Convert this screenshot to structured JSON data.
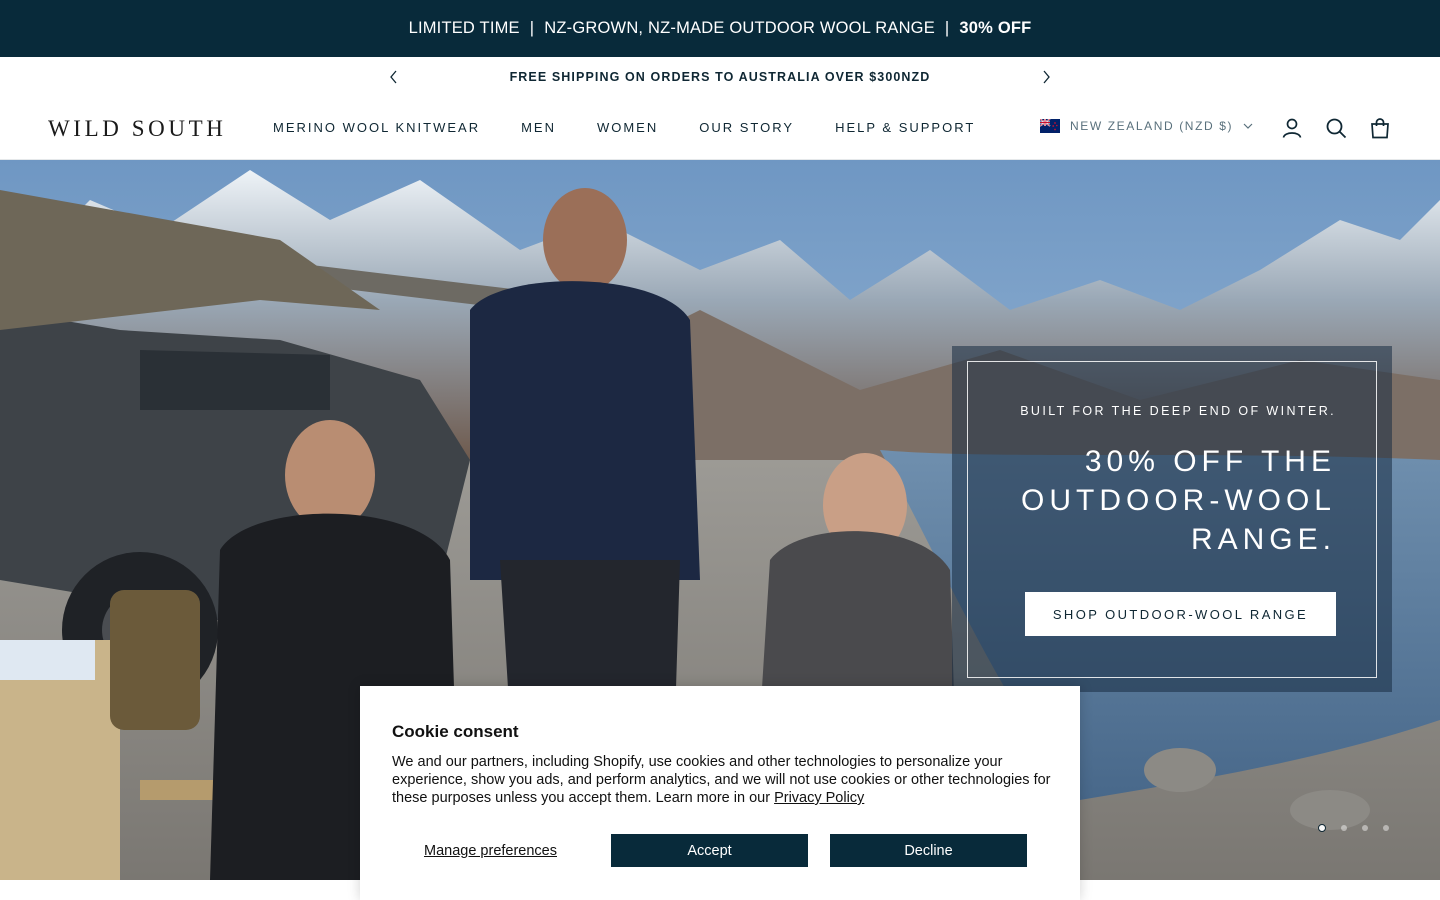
{
  "announcement": {
    "part1": "LIMITED TIME",
    "separator": "|",
    "part2": "NZ-GROWN, NZ-MADE OUTDOOR WOOL RANGE",
    "highlight": "30% OFF"
  },
  "shipping_bar": {
    "text": "FREE SHIPPING ON ORDERS TO AUSTRALIA OVER $300NZD",
    "prev_icon": "chevron-left-icon",
    "next_icon": "chevron-right-icon"
  },
  "header": {
    "logo": "WILD SOUTH",
    "nav": [
      {
        "label": "MERINO WOOL KNITWEAR"
      },
      {
        "label": "MEN"
      },
      {
        "label": "WOMEN"
      },
      {
        "label": "OUR STORY"
      },
      {
        "label": "HELP & SUPPORT"
      }
    ],
    "locale": {
      "label": "NEW ZEALAND (NZD $)",
      "flag_icon": "nz-flag-icon",
      "chevron_icon": "chevron-down-icon"
    },
    "icons": [
      "account-icon",
      "search-icon",
      "cart-icon"
    ]
  },
  "hero": {
    "kicker": "BUILT FOR THE DEEP END OF WINTER.",
    "heading": "30% OFF THE OUTDOOR-WOOL RANGE.",
    "cta": "SHOP OUTDOOR-WOOL RANGE",
    "slides_total": 4,
    "slide_active": 1
  },
  "cookie_banner": {
    "title": "Cookie consent",
    "body": "We and our partners, including Shopify, use cookies and other technologies to personalize your experience, show you ads, and perform analytics, and we will not use cookies or other technologies for these purposes unless you accept them. Learn more in our ",
    "policy_link": "Privacy Policy",
    "manage_label": "Manage preferences",
    "accept_label": "Accept",
    "decline_label": "Decline"
  },
  "colors": {
    "navy": "#082a3a",
    "text": "#0f2733",
    "white": "#ffffff"
  }
}
